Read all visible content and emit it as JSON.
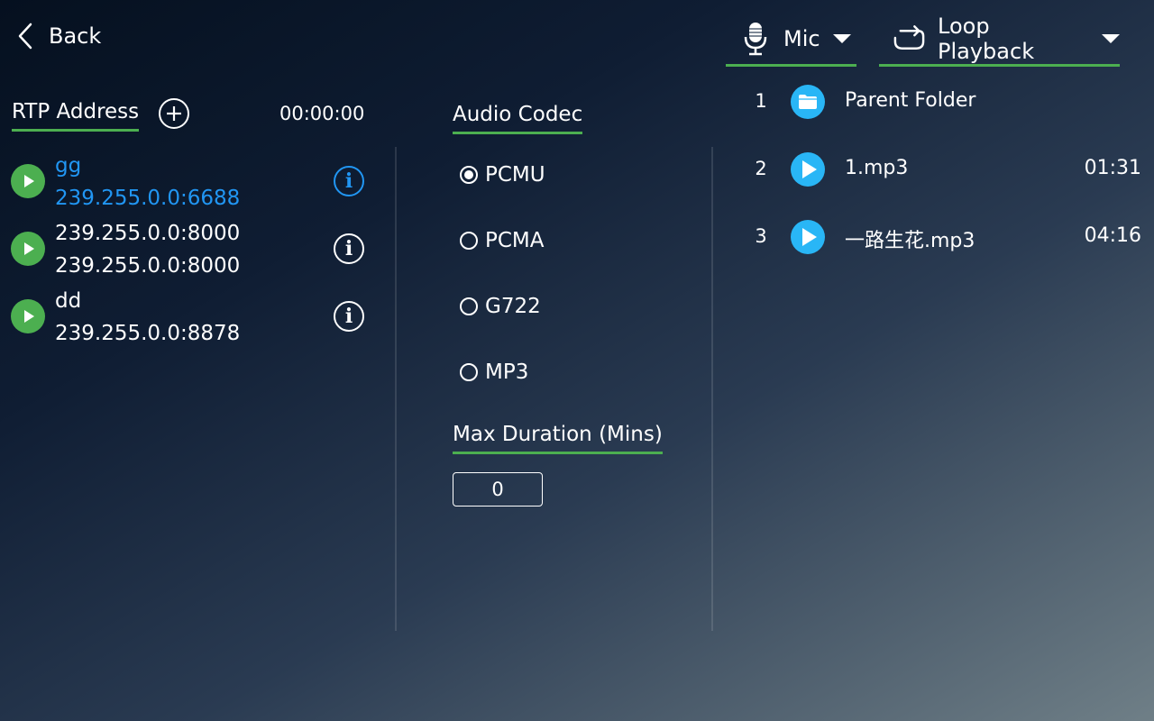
{
  "topbar": {
    "back_label": "Back",
    "mic_dropdown_label": "Mic",
    "playback_dropdown_label": "Loop Playback"
  },
  "rtp": {
    "title": "RTP Address",
    "timer": "00:00:00",
    "items": [
      {
        "name": "gg",
        "address": "239.255.0.0:6688",
        "active": true
      },
      {
        "name": "239.255.0.0:8000",
        "address": "239.255.0.0:8000",
        "active": false
      },
      {
        "name": "dd",
        "address": "239.255.0.0:8878",
        "active": false
      }
    ]
  },
  "codec": {
    "title": "Audio Codec",
    "options": [
      "PCMU",
      "PCMA",
      "G722",
      "MP3"
    ],
    "selected": "PCMU"
  },
  "max_duration": {
    "title": "Max Duration (Mins)",
    "value": "0"
  },
  "files": {
    "items": [
      {
        "index": "1",
        "name": "Parent Folder",
        "duration": "",
        "icon": "folder-icon"
      },
      {
        "index": "2",
        "name": "1.mp3",
        "duration": "01:31",
        "icon": "play-icon"
      },
      {
        "index": "3",
        "name": "一路生花.mp3",
        "duration": "04:16",
        "icon": "play-icon"
      }
    ]
  },
  "colors": {
    "accent_green": "#4caf50",
    "active_blue": "#2196f3",
    "file_icon_blue": "#29b6f6"
  }
}
